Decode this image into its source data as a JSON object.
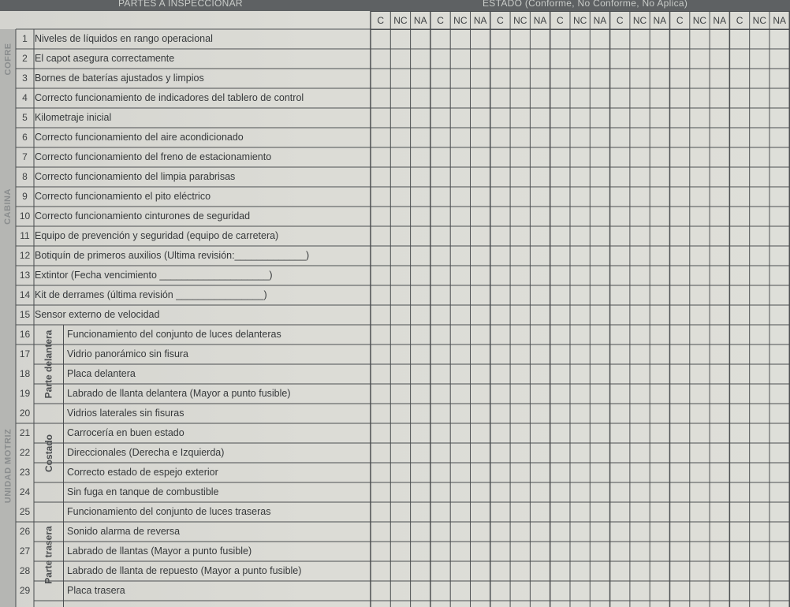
{
  "header": {
    "left_title": "PARTES A INSPECCIONAR",
    "right_title": "ESTADO (Conforme, No Conforme, No Aplica)"
  },
  "status_codes": [
    "C",
    "NC",
    "NA",
    "C",
    "NC",
    "NA",
    "C",
    "NC",
    "NA",
    "C",
    "NC",
    "NA",
    "C",
    "NC",
    "NA",
    "C",
    "NC",
    "NA",
    "C",
    "NC",
    "NA"
  ],
  "sections": [
    {
      "label": "COFRE"
    },
    {
      "label": "CABINA"
    },
    {
      "label": "UNIDAD MOTRIZ"
    }
  ],
  "subsections": [
    {
      "label": "Parte delantera"
    },
    {
      "label": "Costado"
    },
    {
      "label": "Parte trasera"
    }
  ],
  "items": [
    {
      "num": "1",
      "text": "Niveles de líquidos en rango operacional"
    },
    {
      "num": "2",
      "text": "El capot asegura correctamente"
    },
    {
      "num": "3",
      "text": "Bornes de baterías ajustados y limpios"
    },
    {
      "num": "4",
      "text": "Correcto funcionamiento de indicadores del tablero de control"
    },
    {
      "num": "5",
      "text": "Kilometraje inicial"
    },
    {
      "num": "6",
      "text": "Correcto funcionamiento del aire acondicionado"
    },
    {
      "num": "7",
      "text": "Correcto funcionamiento del freno de estacionamiento"
    },
    {
      "num": "8",
      "text": "Correcto funcionamiento del limpia parabrisas"
    },
    {
      "num": "9",
      "text": "Correcto funcionamiento el pito eléctrico"
    },
    {
      "num": "10",
      "text": "Correcto funcionamiento cinturones de seguridad"
    },
    {
      "num": "11",
      "text": "Equipo de prevención y seguridad (equipo de carretera)"
    },
    {
      "num": "12",
      "text": "Botiquín de primeros auxilios (Ultima revisión:_____________)"
    },
    {
      "num": "13",
      "text": "Extintor  (Fecha vencimiento ____________________)"
    },
    {
      "num": "14",
      "text": "Kit de derrames (última revisión ________________)"
    },
    {
      "num": "15",
      "text": "Sensor externo de velocidad"
    },
    {
      "num": "16",
      "text": "Funcionamiento del conjunto de luces delanteras"
    },
    {
      "num": "17",
      "text": "Vidrio panorámico sin fisura"
    },
    {
      "num": "18",
      "text": "Placa delantera"
    },
    {
      "num": "19",
      "text": "Labrado de llanta delantera (Mayor a punto fusible)"
    },
    {
      "num": "20",
      "text": "Vidrios laterales sin fisuras"
    },
    {
      "num": "21",
      "text": "Carrocería en buen estado"
    },
    {
      "num": "22",
      "text": "Direccionales (Derecha e Izquierda)"
    },
    {
      "num": "23",
      "text": "Correcto estado de espejo exterior"
    },
    {
      "num": "24",
      "text": "Sin fuga en tanque de combustible"
    },
    {
      "num": "25",
      "text": "Funcionamiento del conjunto de luces traseras"
    },
    {
      "num": "26",
      "text": "Sonido alarma de reversa"
    },
    {
      "num": "27",
      "text": "Labrado de llantas (Mayor a punto fusible)"
    },
    {
      "num": "28",
      "text": "Labrado de llanta de repuesto  (Mayor a punto fusible)"
    },
    {
      "num": "29",
      "text": "Placa trasera"
    }
  ]
}
